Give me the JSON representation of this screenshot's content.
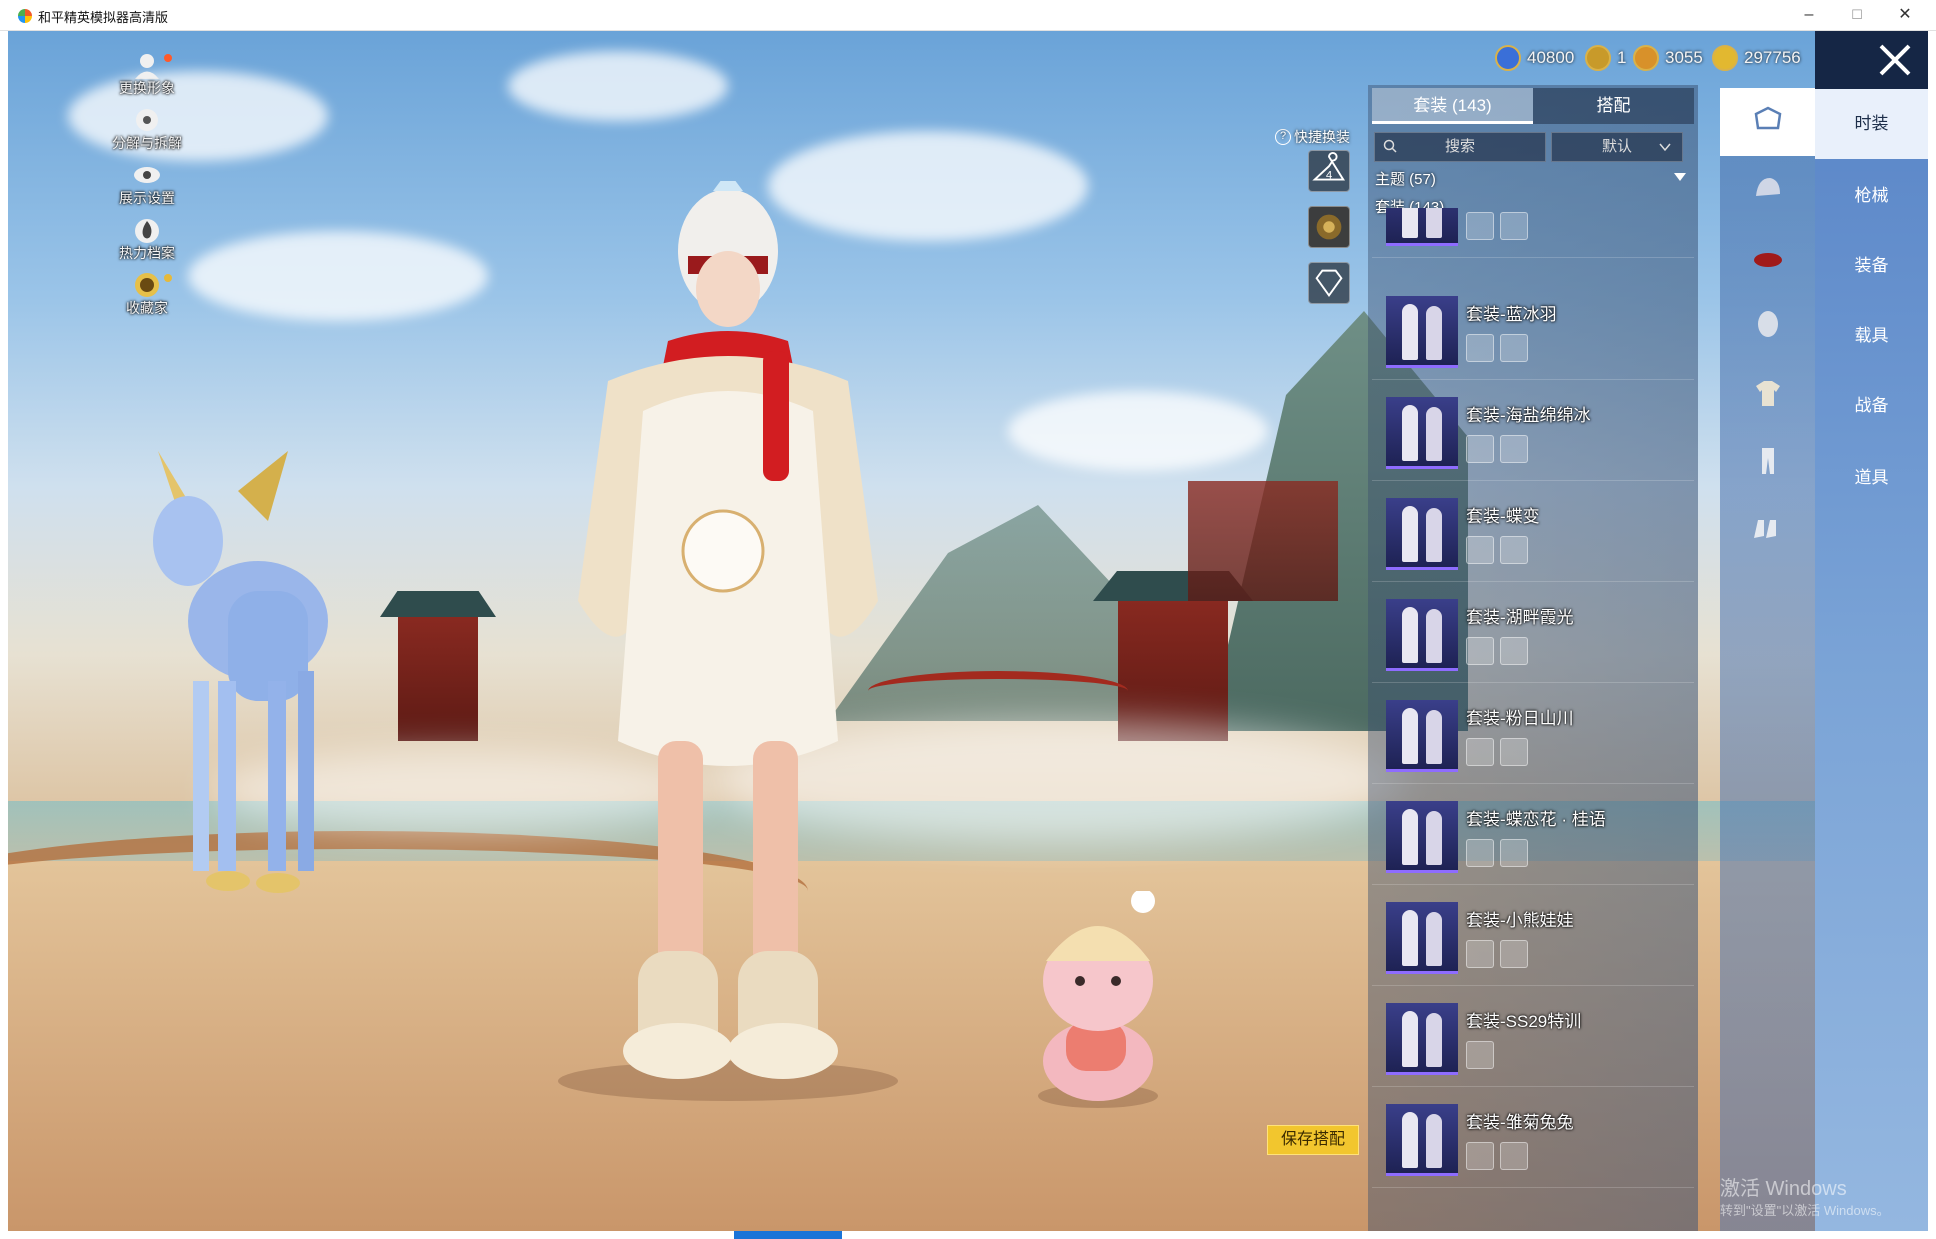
{
  "window": {
    "title": "和平精英模拟器高清版",
    "minimize": "–",
    "maximize": "☐",
    "close": "✕"
  },
  "left_menu": [
    {
      "label": "更换形象",
      "icon": "avatar-icon",
      "badge": true
    },
    {
      "label": "分解与拆解",
      "icon": "gear-icon",
      "badge": false
    },
    {
      "label": "展示设置",
      "icon": "eye-icon",
      "badge": false
    },
    {
      "label": "热力档案",
      "icon": "flame-icon",
      "badge": false
    },
    {
      "label": "收藏家",
      "icon": "collector-badge-icon",
      "badge": true
    }
  ],
  "currencies": [
    {
      "value": "40800",
      "color": "#3a6fd8",
      "icon": "coupon-icon"
    },
    {
      "value": "1",
      "color": "#c89a2a",
      "icon": "gold-token-icon"
    },
    {
      "value": "3055",
      "color": "#d8912a",
      "icon": "bronze-coin-icon"
    },
    {
      "value": "297756",
      "color": "#e2b830",
      "icon": "gold-coin-icon"
    }
  ],
  "quick_change": {
    "label": "快捷换装",
    "help": "?",
    "slot_number": "4"
  },
  "tabs": [
    {
      "label": "套装 (143)",
      "active": true
    },
    {
      "label": "搭配",
      "active": false
    }
  ],
  "search": {
    "placeholder": "搜索"
  },
  "sort": {
    "selected": "默认"
  },
  "categories": {
    "theme": "主题 (57)",
    "suits": "套装 (143)"
  },
  "items": [
    {
      "name": "",
      "parts": 2
    },
    {
      "name": "套装-蓝冰羽",
      "parts": 2
    },
    {
      "name": "套装-海盐绵绵冰",
      "parts": 2
    },
    {
      "name": "套装-蝶变",
      "parts": 2
    },
    {
      "name": "套装-湖畔霞光",
      "parts": 2
    },
    {
      "name": "套装-粉日山川",
      "parts": 2
    },
    {
      "name": "套装-蝶恋花 · 桂语",
      "parts": 2
    },
    {
      "name": "套装-小熊娃娃",
      "parts": 2
    },
    {
      "name": "套装-SS29特训",
      "parts": 1
    },
    {
      "name": "套装-雏菊兔兔",
      "parts": 2
    }
  ],
  "side_icons": [
    "outfit-icon",
    "helmet-icon",
    "hat-icon",
    "mask-icon",
    "top-icon",
    "pants-icon",
    "shoes-icon"
  ],
  "categories_right": [
    {
      "label": "时装",
      "active": true
    },
    {
      "label": "枪械",
      "active": false
    },
    {
      "label": "装备",
      "active": false
    },
    {
      "label": "载具",
      "active": false
    },
    {
      "label": "战备",
      "active": false
    },
    {
      "label": "道具",
      "active": false
    }
  ],
  "save_button": "保存搭配",
  "watermark": {
    "line1": "激活 Windows",
    "line2": "转到\"设置\"以激活 Windows。"
  }
}
